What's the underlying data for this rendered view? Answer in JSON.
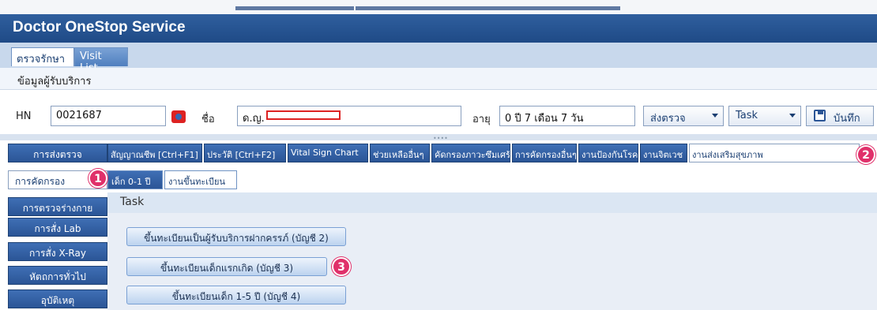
{
  "app": {
    "title": "Doctor OneStop Service"
  },
  "tabs": [
    {
      "label": "ตรวจรักษา",
      "active": true
    },
    {
      "label": "Visit List",
      "active": false
    }
  ],
  "section": {
    "title": "ข้อมูลผู้รับบริการ"
  },
  "patient": {
    "hn_label": "HN",
    "hn_value": "0021687",
    "name_label": "ชื่อ",
    "name_value": "ด.ญ.",
    "age_label": "อายุ",
    "age_value": "0 ปี 7 เดือน 7 วัน",
    "send_combo": "ส่งตรวจ",
    "task_combo": "Task",
    "save_label": "บันทึก"
  },
  "left_tabs": [
    {
      "label": "การส่งตรวจ",
      "active": false
    },
    {
      "label": "การคัดกรอง",
      "active": true
    },
    {
      "label": "การตรวจร่างกาย",
      "active": false
    },
    {
      "label": "การสั่ง Lab",
      "active": false
    },
    {
      "label": "การสั่ง X-Ray",
      "active": false
    },
    {
      "label": "หัตถการทั่วไป",
      "active": false
    },
    {
      "label": "อุบัติเหตุ",
      "active": false
    }
  ],
  "top_tabs": [
    {
      "label": "สัญญาณชีพ [Ctrl+F1]"
    },
    {
      "label": "ประวัติ [Ctrl+F2]"
    },
    {
      "label": "Vital Sign Chart"
    },
    {
      "label": "ช่วยเหลืออื่นๆ"
    },
    {
      "label": "คัดกรองภาวะซึมเศร้า"
    },
    {
      "label": "การคัดกรองอื่นๆ"
    },
    {
      "label": "งานป้องกันโรค"
    },
    {
      "label": "งานจิตเวช"
    },
    {
      "label": "งานส่งเสริมสุขภาพ"
    }
  ],
  "sub_tabs": [
    {
      "label": "เด็ก 0-1 ปี",
      "active": true
    },
    {
      "label": "งานขึ้นทะเบียน",
      "active": false
    }
  ],
  "task_label": "Task",
  "buttons": [
    {
      "label": "ขึ้นทะเบียนเป็นผู้รับบริการฝากครรภ์ (บัญชี 2)"
    },
    {
      "label": "ขึ้นทะเบียนเด็กแรกเกิด (บัญชี 3)"
    },
    {
      "label": "ขึ้นทะเบียนเด็ก 1-5 ปี (บัญชี 4)"
    }
  ],
  "badges": [
    "1",
    "2",
    "3"
  ],
  "colors": {
    "title_bar": "#1f4a86",
    "tab_blue": "#2b5596",
    "badge": "#e0306a",
    "redaction": "#dd2222"
  }
}
